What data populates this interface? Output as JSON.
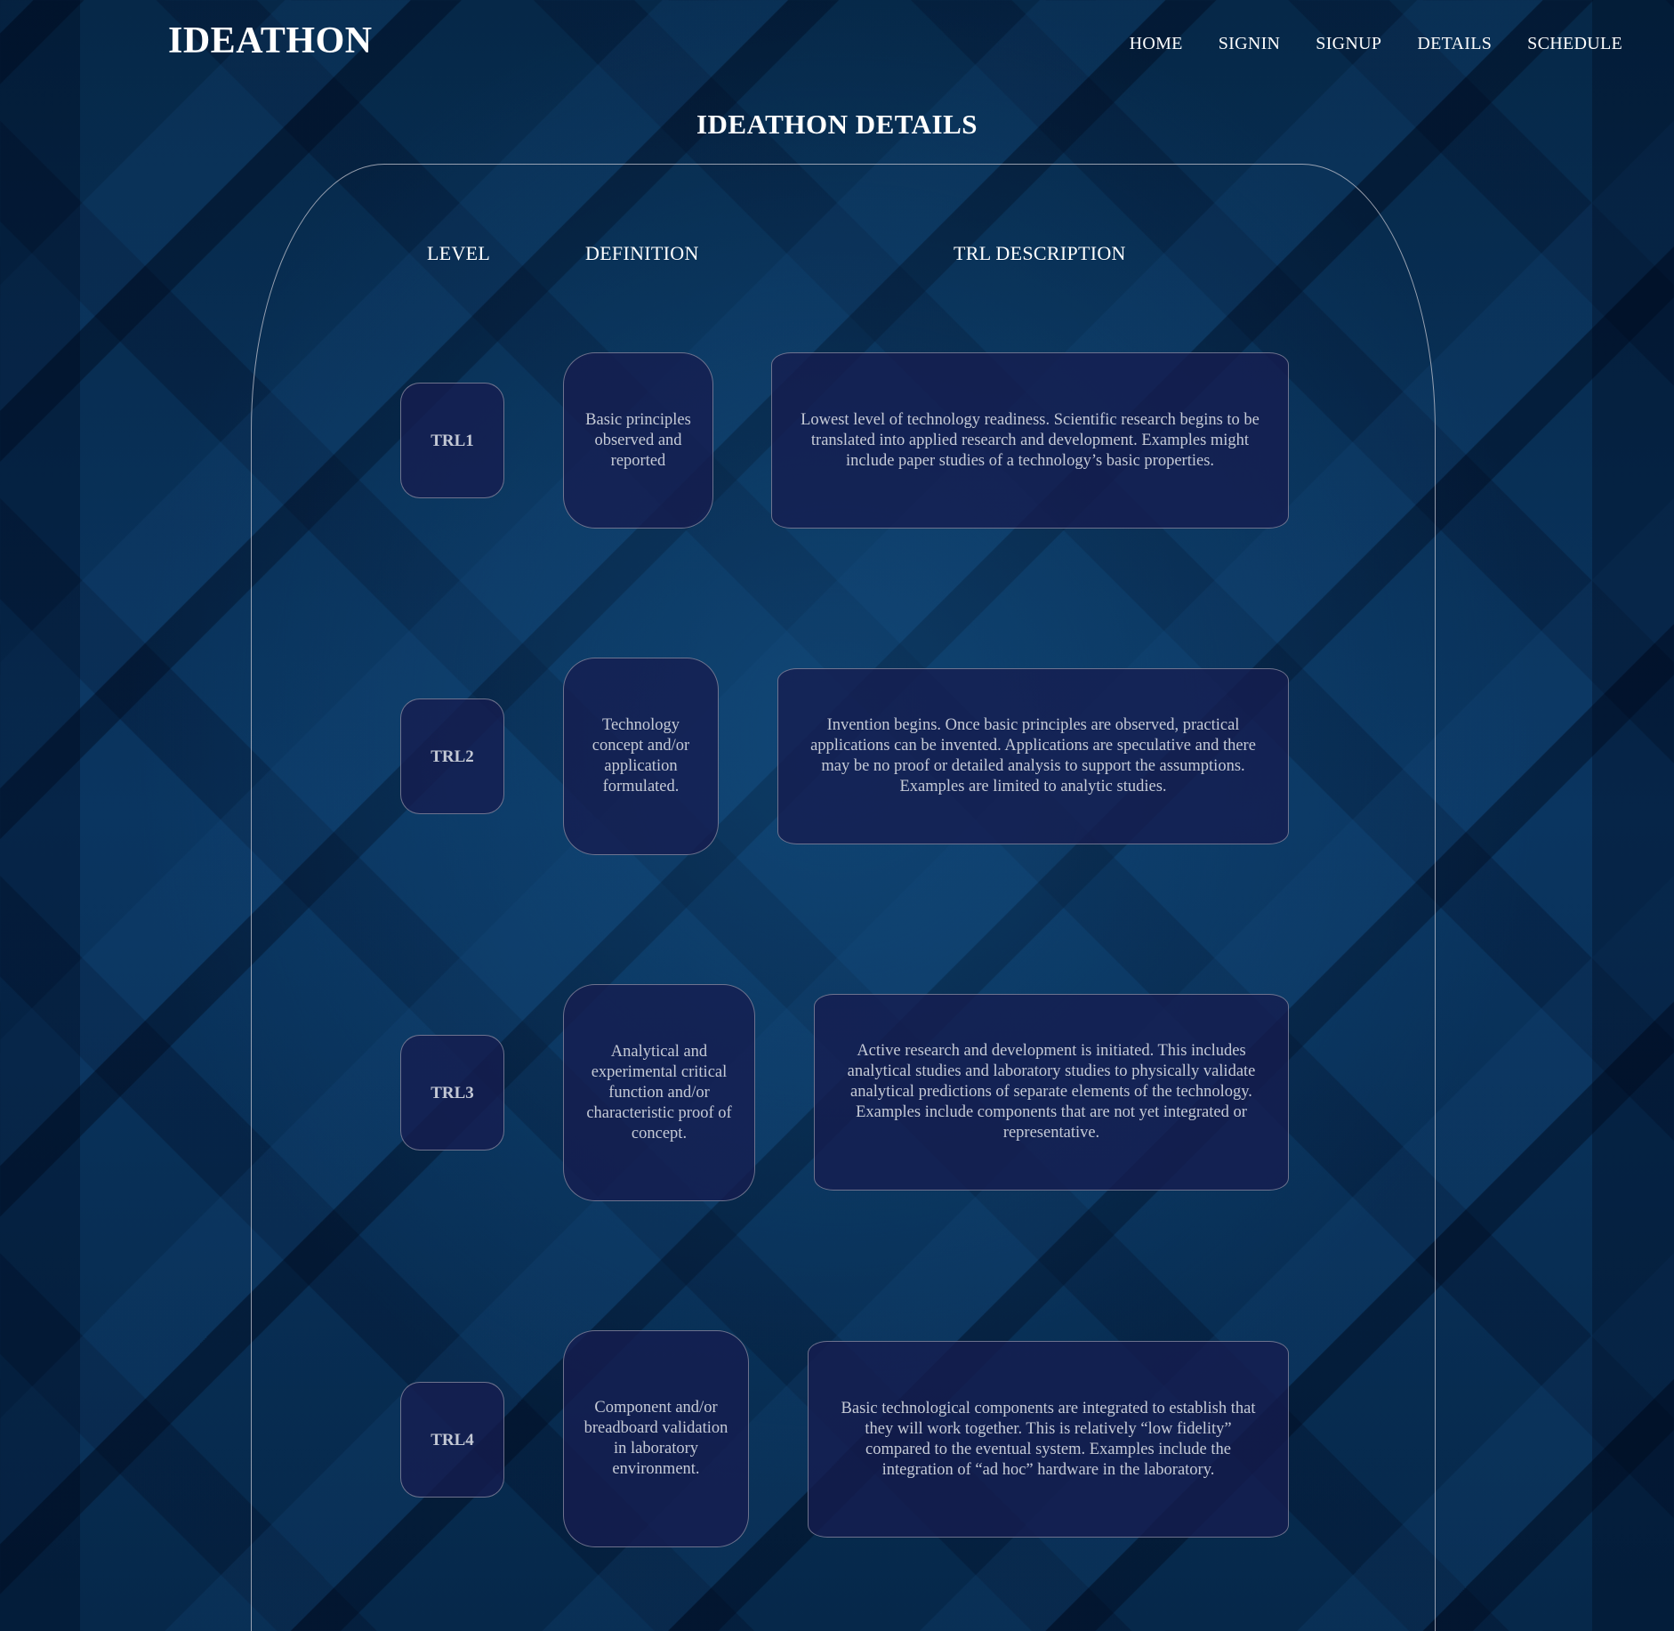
{
  "header": {
    "brand": "IDEATHON",
    "nav": [
      "HOME",
      "SIGNIN",
      "SIGNUP",
      "DETAILS",
      "SCHEDULE"
    ]
  },
  "page_title": "IDEATHON DETAILS",
  "table": {
    "columns": [
      "LEVEL",
      "DEFINITION",
      "TRL DESCRIPTION"
    ],
    "rows": [
      {
        "level": "TRL1",
        "definition": "Basic principles observed and reported",
        "description": "Lowest level of technology readiness. Scientific research begins to be translated into applied research and development. Examples might include paper studies of a technology’s basic properties."
      },
      {
        "level": "TRL2",
        "definition": "Technology concept and/or application formulated.",
        "description": "Invention begins. Once basic principles are observed, practical applications can be invented. Applications are speculative and there may be no proof or detailed analysis to support the assumptions. Examples are limited to analytic studies."
      },
      {
        "level": "TRL3",
        "definition": "Analytical and experimental critical function and/or characteristic proof of concept.",
        "description": "Active research and development is initiated. This includes analytical studies and laboratory studies to physically validate analytical predictions of separate elements of the technology. Examples include components that are not yet integrated or representative."
      },
      {
        "level": "TRL4",
        "definition": "Component and/or breadboard validation in laboratory environment.",
        "description": "Basic technological components are integrated to establish that they will work together. This is relatively “low fidelity” compared to the eventual system. Examples include the integration of “ad hoc” hardware in the laboratory."
      }
    ]
  },
  "colors": {
    "background": "#04203e",
    "cell_fill": "#161c50",
    "cell_border": "#a0a0af",
    "text": "#ffffff",
    "cell_text": "#c5cad6"
  }
}
